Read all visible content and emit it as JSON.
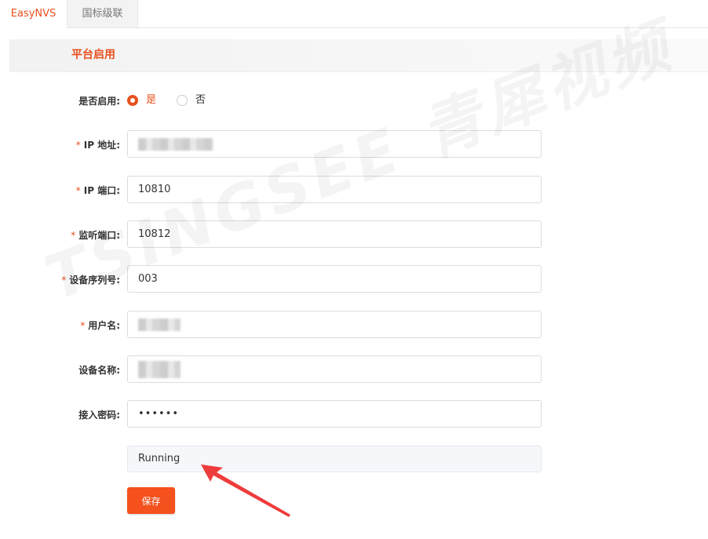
{
  "tabs": [
    {
      "label": "EasyNVS"
    },
    {
      "label": "国标级联"
    }
  ],
  "section": {
    "title": "平台启用"
  },
  "form": {
    "enable": {
      "label": "是否启用:",
      "yes": "是",
      "no": "否",
      "selected": "是"
    },
    "ip_address": {
      "label": "IP 地址:",
      "value": ""
    },
    "ip_port": {
      "label": "IP 端口:",
      "value": "10810"
    },
    "listen_port": {
      "label": "监听端口:",
      "value": "10812"
    },
    "device_serial": {
      "label": "设备序列号:",
      "value": "003"
    },
    "username": {
      "label": "用户名:",
      "value": ""
    },
    "device_name": {
      "label": "设备名称:",
      "value": ""
    },
    "access_password": {
      "label": "接入密码:",
      "value": "••••••"
    },
    "required_mark": "*"
  },
  "status": {
    "text": "Running"
  },
  "save_button": {
    "label": "保存"
  },
  "watermark": {
    "text": "TSINGSEE 青犀视频"
  },
  "colors": {
    "accent": "#e8501e",
    "button": "#f4511e",
    "arrow": "#ee3c3c"
  }
}
